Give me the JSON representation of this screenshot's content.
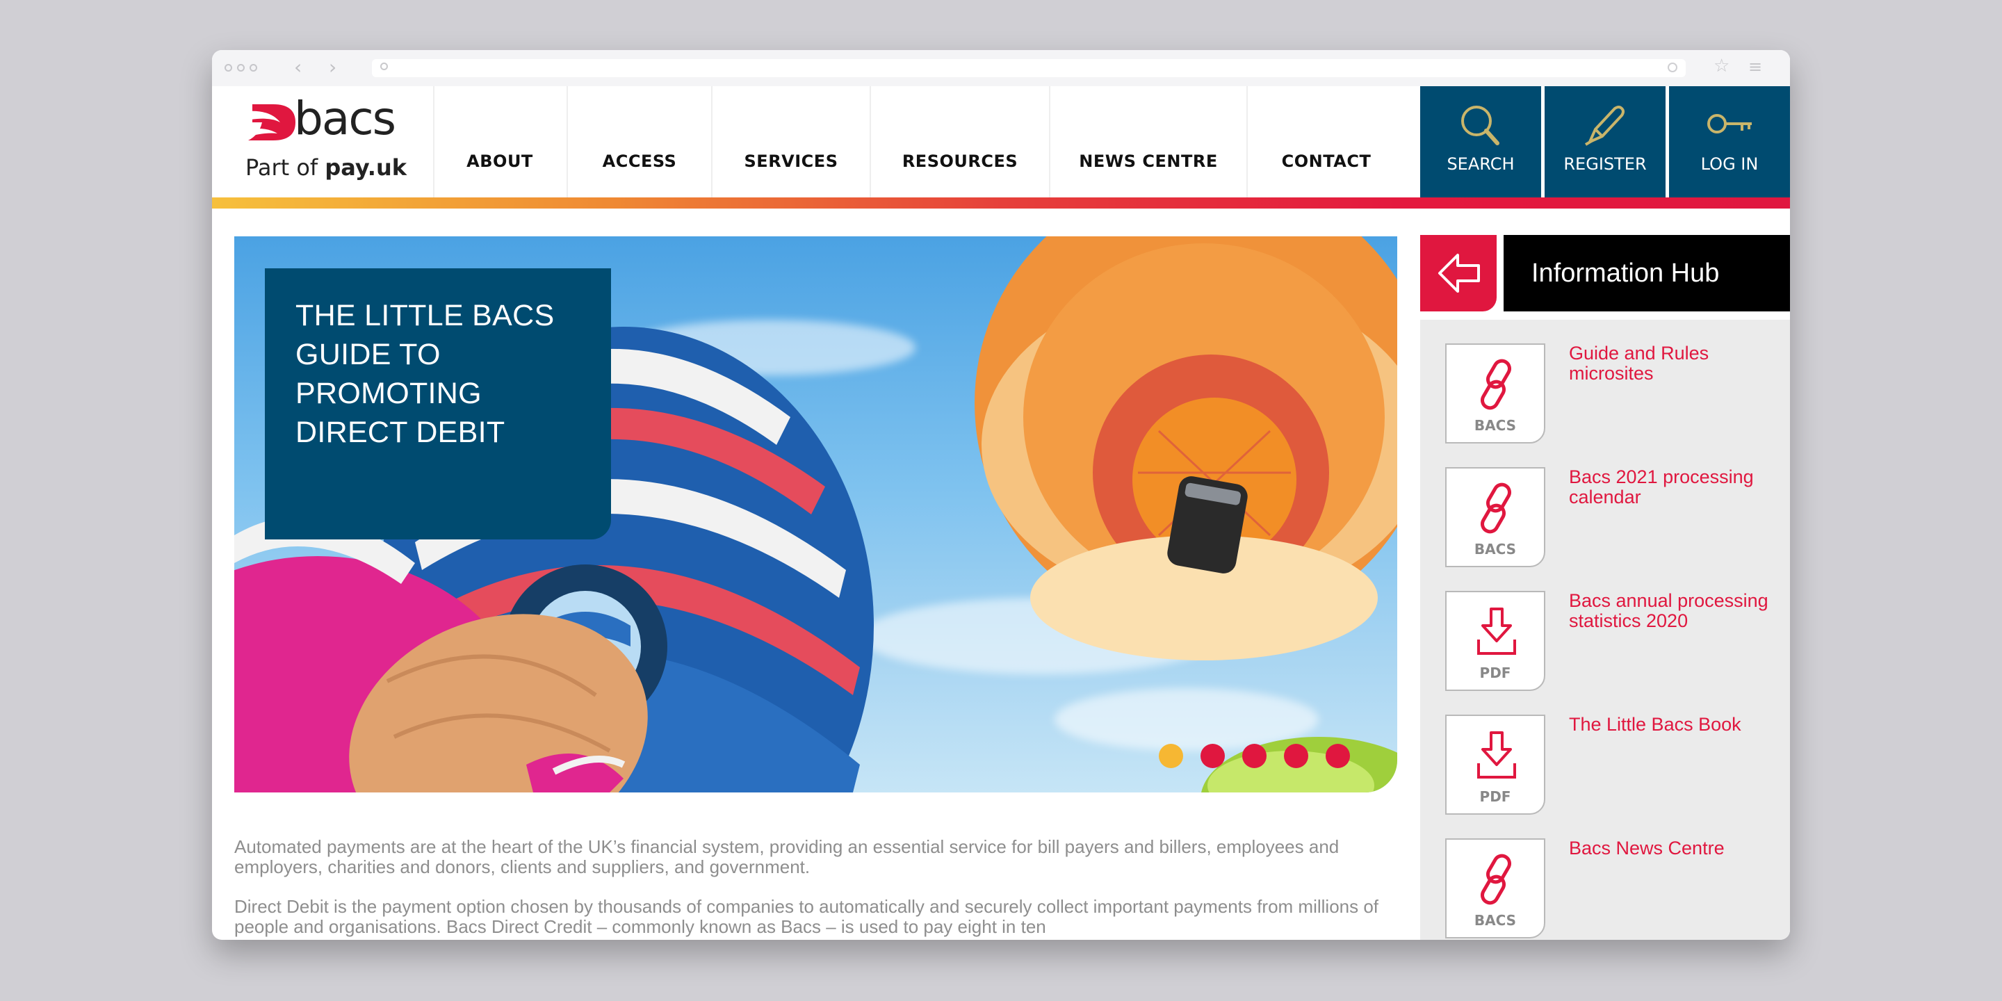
{
  "logo": {
    "brand": "bacs",
    "sub_prefix": "Part of ",
    "sub_bold": "pay.uk"
  },
  "nav": [
    "ABOUT",
    "ACCESS",
    "SERVICES",
    "RESOURCES",
    "NEWS CENTRE",
    "CONTACT"
  ],
  "utility": {
    "search": "SEARCH",
    "register": "REGISTER",
    "login": "LOG IN"
  },
  "hero": {
    "title": "THE LITTLE BACS GUIDE TO PROMOTING DIRECT DEBIT",
    "dots_active_index": 0,
    "colors": {
      "active": "#f6b733",
      "inactive": "#e0173f"
    }
  },
  "body": {
    "p1": "Automated payments are at the heart of the UK’s financial system, providing an essential service for bill payers and billers, employees and employers, charities and donors, clients and suppliers, and government.",
    "p2": "Direct Debit is the payment option chosen by thousands of companies to automatically and securely collect important payments from millions of people and organisations. Bacs Direct Credit – commonly known as Bacs – is used to pay eight in ten"
  },
  "hub": {
    "title": "Information Hub",
    "items": [
      {
        "tag": "BACS",
        "icon": "link-icon",
        "label": "Guide and Rules microsites"
      },
      {
        "tag": "BACS",
        "icon": "link-icon",
        "label": "Bacs 2021 processing calendar"
      },
      {
        "tag": "PDF",
        "icon": "download-icon",
        "label": "Bacs annual processing statistics 2020"
      },
      {
        "tag": "PDF",
        "icon": "download-icon",
        "label": "The Little Bacs Book"
      },
      {
        "tag": "BACS",
        "icon": "link-icon",
        "label": "Bacs News Centre"
      }
    ]
  },
  "colors": {
    "navy": "#004b70",
    "red": "#e0173f",
    "yellow": "#f6c03c"
  }
}
